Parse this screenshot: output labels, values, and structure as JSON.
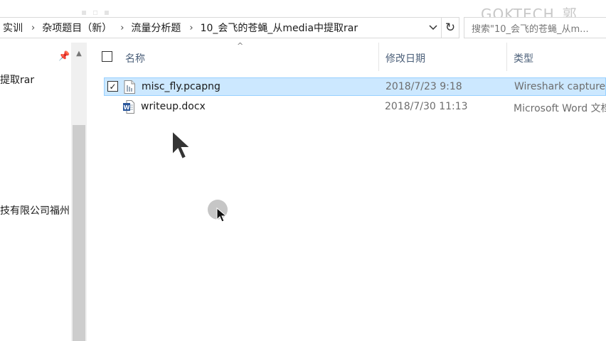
{
  "watermark": "GOKTECH_郭",
  "address_bar": {
    "crumbs": [
      "实训",
      "杂项题目（新）",
      "流量分析题",
      "10_会飞的苍蝇_从media中提取rar"
    ],
    "dropdown_icon": "chevron-down-icon",
    "refresh_icon": "refresh-icon"
  },
  "search": {
    "placeholder": "搜索\"10_会飞的苍蝇_从m..."
  },
  "nav_pane": {
    "pin_icon": "pin-icon",
    "items": [
      {
        "label": "提取rar"
      },
      {
        "label": "技有限公司福州"
      }
    ]
  },
  "columns": {
    "name": "名称",
    "modified": "修改日期",
    "type": "类型"
  },
  "files": [
    {
      "name": "misc_fly.pcapng",
      "modified": "2018/7/23 9:18",
      "type": "Wireshark capture",
      "icon": "pcapng-file-icon",
      "selected": true,
      "checked": true
    },
    {
      "name": "writeup.docx",
      "modified": "2018/7/30 11:13",
      "type": "Microsoft Word 文档",
      "icon": "word-document-icon",
      "selected": false,
      "checked": false
    }
  ],
  "colors": {
    "selected_row": "#cce8ff",
    "selected_border": "#99d1ff",
    "header_text": "#4c607a",
    "word_blue": "#2b579a"
  }
}
